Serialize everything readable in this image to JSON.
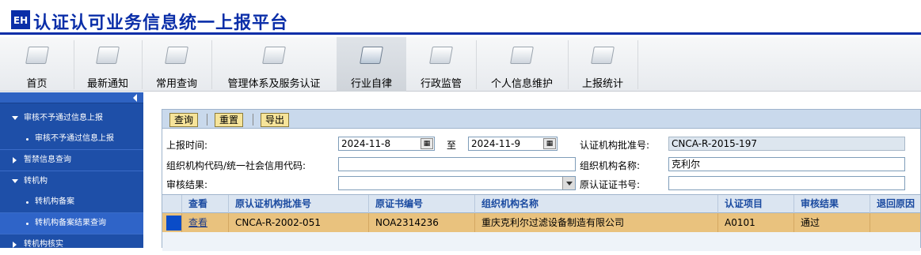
{
  "header": {
    "logo_text": "EH",
    "title": "认证认可业务信息统一上报平台"
  },
  "toolbar": {
    "items": [
      {
        "label": "首页"
      },
      {
        "label": "最新通知"
      },
      {
        "label": "常用查询"
      },
      {
        "label": "管理体系及服务认证"
      },
      {
        "label": "行业自律"
      },
      {
        "label": "行政监管"
      },
      {
        "label": "个人信息维护"
      },
      {
        "label": "上报统计"
      }
    ],
    "active": "行业自律"
  },
  "sidebar": {
    "items": [
      {
        "label": "审核不予通过信息上报"
      },
      {
        "label": "审核不予通过信息上报"
      },
      {
        "label": "暂禁信息查询"
      },
      {
        "label": "转机构"
      },
      {
        "label": "转机构备案"
      },
      {
        "label": "转机构备案结果查询"
      },
      {
        "label": "转机构核实"
      }
    ]
  },
  "actions": {
    "query": "查询",
    "reset": "重置",
    "export": "导出"
  },
  "form": {
    "report_time_label": "上报时间:",
    "date_from": "2024-11-8",
    "to_label": "至",
    "date_to": "2024-11-9",
    "approval_no_label": "认证机构批准号:",
    "approval_no": "CNCA-R-2015-197",
    "org_code_label": "组织机构代码/统一社会信用代码:",
    "org_code": "",
    "org_name_label": "组织机构名称:",
    "org_name": "克利尔",
    "audit_result_label": "审核结果:",
    "audit_result": "",
    "orig_cert_label": "原认证证书号:",
    "orig_cert": ""
  },
  "grid": {
    "columns": [
      "查看",
      "原认证机构批准号",
      "原证书编号",
      "组织机构名称",
      "认证项目",
      "审核结果",
      "退回原因"
    ],
    "rows": [
      {
        "view": "查看",
        "orig_approval": "CNCA-R-2002-051",
        "orig_cert": "NOA2314236",
        "org_name": "重庆克利尔过滤设备制造有限公司",
        "project": "A0101",
        "result": "通过",
        "reason": ""
      }
    ]
  }
}
